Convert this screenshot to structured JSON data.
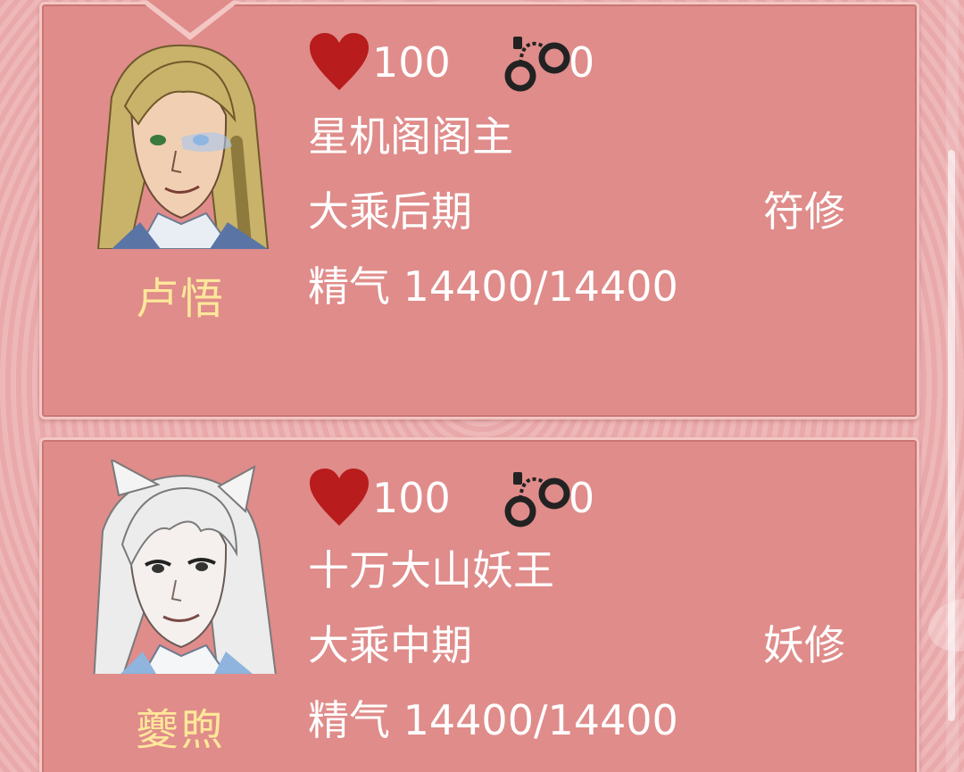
{
  "characters": [
    {
      "name": "卢悟",
      "health": "100",
      "captured": "0",
      "title": "星机阁阁主",
      "realm": "大乘后期",
      "cultivation_type": "符修",
      "essence_label": "精气",
      "essence_value": "14400/14400",
      "hair_color": "#c9b26a",
      "portrait_icon": "portrait-blonde-scholar"
    },
    {
      "name": "夔煦",
      "health": "100",
      "captured": "0",
      "title": "十万大山妖王",
      "realm": "大乘中期",
      "cultivation_type": "妖修",
      "essence_label": "精气",
      "essence_value": "14400/14400",
      "hair_color": "#e8e8e8",
      "portrait_icon": "portrait-white-fox"
    }
  ],
  "colors": {
    "card_bg": "#df8c8a",
    "name_color": "#ffe79a",
    "heart_color": "#b81c1c"
  }
}
